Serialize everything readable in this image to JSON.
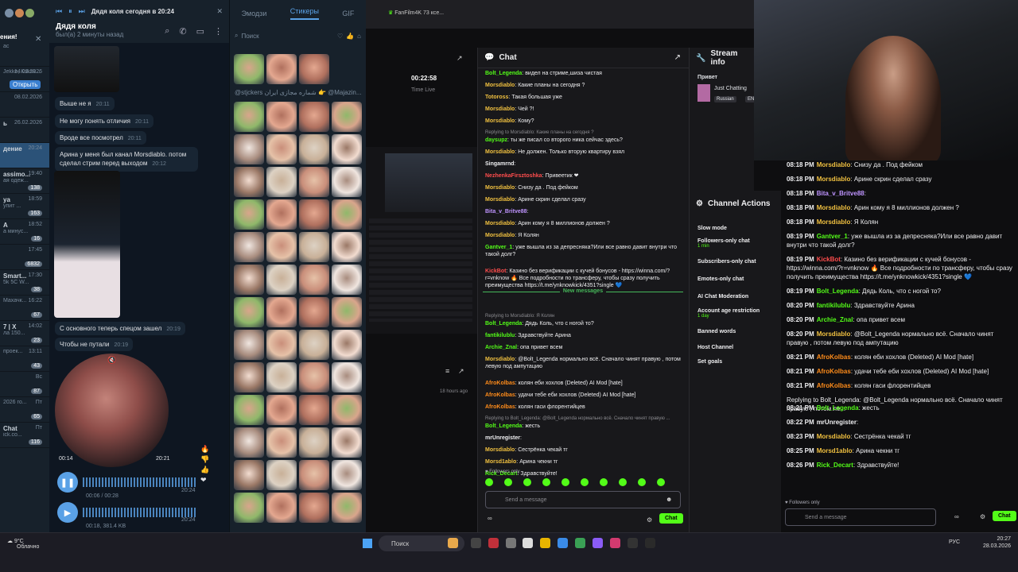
{
  "colors": {
    "kick_green": "#53fc18",
    "telegram_blue": "#5aa1e6",
    "ai_mod": "#e3a11d"
  },
  "tg_list": {
    "header_partial": "ения!",
    "rows": [
      {
        "name": "",
        "sub": "ас",
        "time": "",
        "badge": ""
      },
      {
        "name": "",
        "sub": "Jekke, Ksksk...",
        "time": "14.03.2026",
        "badge": "",
        "button": "Открыть"
      },
      {
        "name": "",
        "sub": "",
        "time": "08.02.2026",
        "badge": ""
      },
      {
        "name": "ь",
        "sub": "",
        "time": "26.02.2026",
        "badge": ""
      },
      {
        "name": "дение",
        "sub": "",
        "time": "20:24",
        "badge": ""
      },
      {
        "name": "assimo...",
        "sub": "ая одеж...",
        "time": "19:40",
        "badge": "138"
      },
      {
        "name": "ya",
        "sub": "упит ...",
        "time": "18:59",
        "badge": "163"
      },
      {
        "name": "A",
        "sub": "а минус...",
        "time": "18:52",
        "badge": "16"
      },
      {
        "name": "",
        "sub": "",
        "time": "17:45",
        "badge": "6832"
      },
      {
        "name": "Smart...",
        "sub": "5k 5C W...",
        "time": "17:30",
        "badge": "38"
      },
      {
        "name": "",
        "sub": "Махачк...",
        "time": "16:22",
        "badge": "67"
      },
      {
        "name": "7 | X",
        "sub": "ла 150...",
        "time": "14:02",
        "badge": "23"
      },
      {
        "name": "",
        "sub": "проек...",
        "time": "13:11",
        "badge": "43"
      },
      {
        "name": "",
        "sub": "",
        "time": "Вс",
        "badge": "87"
      },
      {
        "name": "",
        "sub": "2026 го...",
        "time": "Пт",
        "badge": "65"
      },
      {
        "name": "Chat",
        "sub": "ick.co...",
        "time": "Пт",
        "badge": "116"
      }
    ]
  },
  "tg_conv": {
    "player_label": "Дядя коля сегодня в 20:24",
    "title": "Дядя коля",
    "status": "был(а) 2 минуты назад",
    "messages": [
      {
        "text": "Выше не я",
        "time": "20:11"
      },
      {
        "text": "Не могу понять отличия",
        "time": "20:11"
      },
      {
        "text": "Вроде все посмотрел",
        "time": "20:11"
      },
      {
        "text": "Арина у меня был канал Morsdiablo. потом сделал стрим перед выходом",
        "time": "20:12"
      },
      {
        "text": "С основного теперь спецом зашел",
        "time": "20:19"
      },
      {
        "text": "Чтобы не путали",
        "time": "20:19"
      }
    ],
    "video_elapsed": "00:14",
    "video_time": "20:21",
    "voice1": {
      "dur": "00:06 / 00:28",
      "time": "20:24"
    },
    "voice2": {
      "dur": "00:18, 381.4 KB",
      "time": "20:24"
    }
  },
  "stickers": {
    "tabs": [
      "Эмодзи",
      "Стикеры",
      "GIF"
    ],
    "search_placeholder": "Поиск",
    "pack_title": "@stjckers شماره مجازی ایران 👉 @Majazin..."
  },
  "browser": {
    "tab_label": "FanFilm4K 73 ксе..."
  },
  "stream_stats": {
    "time": "00:22:58",
    "status": "Time Live",
    "hours_ago": "18 hours ago"
  },
  "chat": {
    "title": "Chat",
    "new_messages": "New messages",
    "followers_only": "Followers only",
    "input_placeholder": "Send a message",
    "send_label": "Chat",
    "lines": [
      {
        "reply": "",
        "user": "Bolt_Legenda",
        "color": "#53fc18",
        "text": "видел на стриме,шиза чистая"
      },
      {
        "reply": "",
        "user": "Morsdiablo",
        "color": "#f0c040",
        "text": "Какие планы на сегодня ?"
      },
      {
        "reply": "",
        "user": "Totoross",
        "color": "#f0c040",
        "text": "Такая большая уже"
      },
      {
        "reply": "",
        "user": "Morsdiablo",
        "color": "#f0c040",
        "text": "Чей ?!"
      },
      {
        "reply": "",
        "user": "Morsdiablo",
        "color": "#f0c040",
        "text": "Кому?"
      },
      {
        "reply": "Replying to Morsdiablo: Какие планы на сегодня ?",
        "user": "daysupz",
        "color": "#53fc18",
        "text": "ты же писал со второго ника сейчас здесь?"
      },
      {
        "reply": "",
        "user": "Morsdiablo",
        "color": "#f0c040",
        "text": "Не должен. Только вторую квартиру взял"
      },
      {
        "reply": "",
        "user": "Singamrnd",
        "color": "#efeff1",
        "text": ""
      },
      {
        "reply": "",
        "user": "NezhenkaFirsztoshka",
        "color": "#ff4d4d",
        "text": "Привеетик ❤"
      },
      {
        "reply": "",
        "user": "Morsdiablo",
        "color": "#f0c040",
        "text": "Снизу да . Под фейком"
      },
      {
        "reply": "",
        "user": "Morsdiablo",
        "color": "#f0c040",
        "text": "Арине скрин сделал сразу"
      },
      {
        "reply": "",
        "user": "Bita_v_Britve88",
        "color": "#bf94ff",
        "text": ""
      },
      {
        "reply": "",
        "user": "Morsdiablo",
        "color": "#f0c040",
        "text": "Арин кому я 8 миллионов должен ?"
      },
      {
        "reply": "",
        "user": "Morsdiablo",
        "color": "#f0c040",
        "text": "Я Колян"
      },
      {
        "reply": "",
        "user": "Gantver_1",
        "color": "#53fc18",
        "text": "уже вышла из за депресняка?Или все равно давит внутри что такой долг?"
      },
      {
        "reply": "",
        "user": "KickBot",
        "color": "#ff4d4d",
        "text": "Казино без верификации с кучей бонусов - https://winna.com/?r=vnknow 🔥 Все подробности по трансферу, чтобы сразу получить преимущества https://t.me/ynknowkick/4351?single 💙"
      },
      {
        "reply": "Replying to Morsdiablo: Я Колян",
        "user": "Bolt_Legenda",
        "color": "#53fc18",
        "text": "Дядь Коль, что с ногой то?"
      },
      {
        "reply": "",
        "user": "fantikilublu",
        "color": "#53fc18",
        "text": "Здравствуйте Арина"
      },
      {
        "reply": "",
        "user": "Archie_Znal",
        "color": "#53fc18",
        "text": "опа привет всем"
      },
      {
        "reply": "",
        "user": "Morsdiablo",
        "color": "#f0c040",
        "text": "@Bolt_Legenda нормально всё. Сначало чинят правую , потом левую под ампутацию"
      },
      {
        "reply": "",
        "user": "AfroKolbas",
        "color": "#ff8c1a",
        "text": "колян еби хохлов (Deleted) AI Mod [hate]"
      },
      {
        "reply": "",
        "user": "AfroKolbas",
        "color": "#ff8c1a",
        "text": "удачи тебе еби хохлов (Deleted) AI Mod [hate]"
      },
      {
        "reply": "",
        "user": "AfroKolbas",
        "color": "#ff8c1a",
        "text": "колян гаси флорентийцев"
      },
      {
        "reply": "Replying to Bolt_Legenda: @Bolt_Legenda нормально всё. Сначало чинят правую ...",
        "user": "Bolt_Legenda",
        "color": "#53fc18",
        "text": "жесть"
      },
      {
        "reply": "",
        "user": "mrUnregister",
        "color": "#efeff1",
        "text": ""
      },
      {
        "reply": "",
        "user": "Morsdiablo",
        "color": "#f0c040",
        "text": "Сестрёнка чекай тг"
      },
      {
        "reply": "",
        "user": "Morsd1ablo",
        "color": "#f0c040",
        "text": "Арина чекни тг"
      },
      {
        "reply": "",
        "user": "Rick_Decart",
        "color": "#53fc18",
        "text": "Здравствуйте!"
      }
    ]
  },
  "stream_info": {
    "title": "Stream info",
    "greeting": "Привет",
    "category": "Just Chatting",
    "lang": "Russian",
    "lang2": "EN"
  },
  "actions": {
    "title": "Channel Actions",
    "items": [
      {
        "label": "Slow mode",
        "sub": ""
      },
      {
        "label": "Followers-only chat",
        "sub": "1 min"
      },
      {
        "label": "Subscribers-only chat",
        "sub": ""
      },
      {
        "label": "Emotes-only chat",
        "sub": ""
      },
      {
        "label": "AI Chat Moderation",
        "sub": ""
      },
      {
        "label": "Account age restriction",
        "sub": "1 day"
      },
      {
        "label": "Banned words",
        "sub": ""
      },
      {
        "label": "Host Channel",
        "sub": ""
      },
      {
        "label": "Set goals",
        "sub": ""
      }
    ]
  },
  "bigchat": {
    "followers_only": "Followers only",
    "input_placeholder": "Send a message",
    "send_label": "Chat",
    "lines": [
      {
        "time": "08:18 PM",
        "user": "Morsdiablo",
        "color": "#f0c040",
        "text": "Снизу да . Под фейком"
      },
      {
        "time": "08:18 PM",
        "user": "Morsdiablo",
        "color": "#f0c040",
        "text": "Арине скрин сделал сразу"
      },
      {
        "time": "08:18 PM",
        "user": "Bita_v_Britve88",
        "color": "#bf94ff",
        "text": ""
      },
      {
        "time": "08:18 PM",
        "user": "Morsdiablo",
        "color": "#f0c040",
        "text": "Арин кому я 8 миллионов должен ?"
      },
      {
        "time": "08:18 PM",
        "user": "Morsdiablo",
        "color": "#f0c040",
        "text": "Я Колян"
      },
      {
        "time": "08:19 PM",
        "user": "Gantver_1",
        "color": "#53fc18",
        "text": "уже вышла из за депресняка?Или все равно давит внутри что такой долг?"
      },
      {
        "time": "08:19 PM",
        "user": "KickBot",
        "color": "#ff4d4d",
        "text": "Казино без верификации с кучей бонусов - https://winna.com/?r=vnknow 🔥 Все подробности по трансферу, чтобы сразу получить преимущества https://t.me/ynknowkick/4351?single 💙"
      },
      {
        "time": "08:19 PM",
        "user": "Bolt_Legenda",
        "color": "#53fc18",
        "text": "Дядь Коль, что с ногой то?"
      },
      {
        "time": "08:20 PM",
        "user": "fantikilublu",
        "color": "#53fc18",
        "text": "Здравствуйте Арина"
      },
      {
        "time": "08:20 PM",
        "user": "Archie_Znal",
        "color": "#53fc18",
        "text": "опа привет всем"
      },
      {
        "time": "08:20 PM",
        "user": "Morsdiablo",
        "color": "#f0c040",
        "text": "@Bolt_Legenda нормально всё. Сначало чинят правую , потом левую под ампутацию"
      },
      {
        "time": "08:21 PM",
        "user": "AfroKolbas",
        "color": "#ff8c1a",
        "text": "колян еби хохлов (Deleted) AI Mod [hate]"
      },
      {
        "time": "08:21 PM",
        "user": "AfroKolbas",
        "color": "#ff8c1a",
        "text": "удачи тебе еби хохлов (Deleted) AI Mod [hate]"
      },
      {
        "time": "08:21 PM",
        "user": "AfroKolbas",
        "color": "#ff8c1a",
        "text": "колян гаси флорентийцев"
      },
      {
        "time": "08:21 PM",
        "user": "Bolt_Legenda",
        "color": "#53fc18",
        "text": "жесть"
      },
      {
        "time": "08:22 PM",
        "user": "mrUnregister",
        "color": "#efeff1",
        "text": ""
      },
      {
        "time": "08:23 PM",
        "user": "Morsdiablo",
        "color": "#f0c040",
        "text": "Сестрёнка чекай тг"
      },
      {
        "time": "08:25 PM",
        "user": "Morsd1ablo",
        "color": "#f0c040",
        "text": "Арина чекни тг"
      },
      {
        "time": "08:26 PM",
        "user": "Rick_Decart",
        "color": "#53fc18",
        "text": "Здравствуйте!"
      }
    ],
    "reply_note": "Replying to Bolt_Legenda: @Bolt_Legenda нормально всё. Сначало чинят правую , потом ле..."
  },
  "taskbar": {
    "temp": "9°C",
    "weather": "Облачно",
    "search_placeholder": "Поиск",
    "lang": "РУС",
    "clock": "20:27",
    "date": "28.03.2026"
  }
}
